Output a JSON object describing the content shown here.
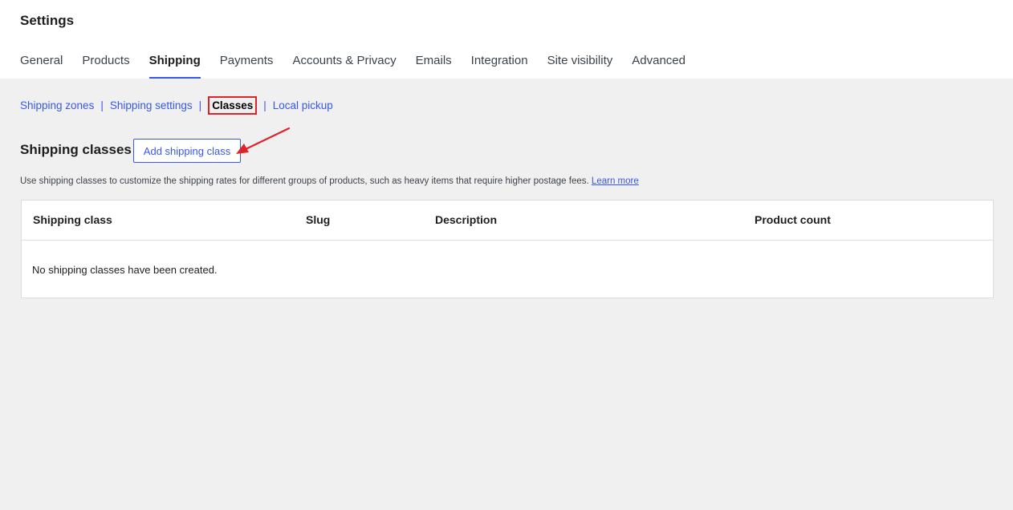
{
  "header": {
    "title": "Settings",
    "tabs": [
      {
        "label": "General",
        "active": false
      },
      {
        "label": "Products",
        "active": false
      },
      {
        "label": "Shipping",
        "active": true
      },
      {
        "label": "Payments",
        "active": false
      },
      {
        "label": "Accounts & Privacy",
        "active": false
      },
      {
        "label": "Emails",
        "active": false
      },
      {
        "label": "Integration",
        "active": false
      },
      {
        "label": "Site visibility",
        "active": false
      },
      {
        "label": "Advanced",
        "active": false
      }
    ]
  },
  "subnav": {
    "items": [
      "Shipping zones",
      "Shipping settings",
      "Classes",
      "Local pickup"
    ],
    "separator": "|",
    "current": "Classes"
  },
  "section": {
    "title": "Shipping classes",
    "add_button": "Add shipping class",
    "description": "Use shipping classes to customize the shipping rates for different groups of products, such as heavy items that require higher postage fees.",
    "learn_more": "Learn more"
  },
  "table": {
    "columns": [
      "Shipping class",
      "Slug",
      "Description",
      "Product count"
    ],
    "empty_message": "No shipping classes have been created."
  },
  "colors": {
    "accent": "#3858e9",
    "highlight": "#e0232b",
    "background": "#f0f0f1"
  }
}
